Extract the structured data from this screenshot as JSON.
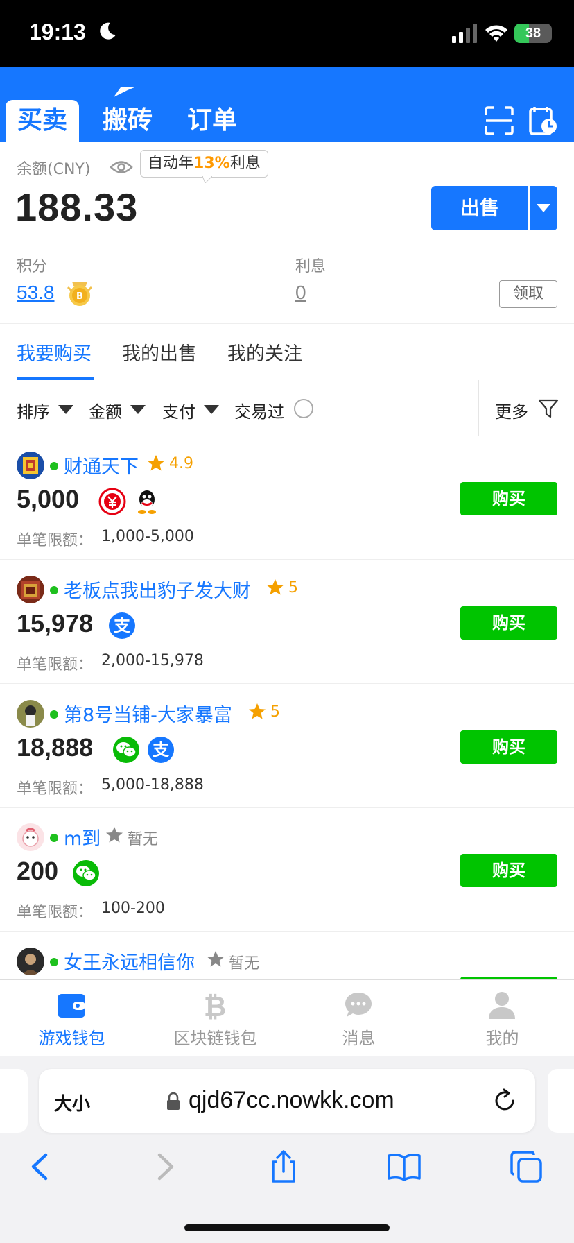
{
  "status_bar": {
    "time": "19:13",
    "battery": "38",
    "battery_level": 0.38
  },
  "header": {
    "tabs": [
      {
        "label": "买卖",
        "active": true
      },
      {
        "label": "搬砖",
        "active": false
      },
      {
        "label": "订单",
        "active": false
      }
    ],
    "icons": [
      "scan-icon",
      "history-clock-icon"
    ]
  },
  "balance": {
    "label": "余额(CNY)",
    "tip_prefix": "自动年",
    "tip_rate": "13%",
    "tip_suffix": "利息",
    "value": "188.33",
    "sell_label": "出售",
    "points_label": "积分",
    "points_value": "53.8",
    "interest_label": "利息",
    "interest_value": "0",
    "claim_label": "领取"
  },
  "subtabs": [
    {
      "label": "我要购买",
      "active": true
    },
    {
      "label": "我的出售",
      "active": false
    },
    {
      "label": "我的关注",
      "active": false
    }
  ],
  "filters": {
    "sort": "排序",
    "amount": "金额",
    "payment": "支付",
    "traded": "交易过",
    "more": "更多"
  },
  "listings": [
    {
      "seller": "财通天下",
      "rating": "4.9",
      "amount": "5,000",
      "payments": [
        "digital-rmb-icon",
        "qq-icon"
      ],
      "limit_label": "单笔限额：",
      "limit": "1,000-5,000",
      "buy_label": "购买"
    },
    {
      "seller": "老板点我出豹子发大财",
      "rating": "5",
      "amount": "15,978",
      "payments": [
        "alipay-icon"
      ],
      "limit_label": "单笔限额：",
      "limit": "2,000-15,978",
      "buy_label": "购买"
    },
    {
      "seller": "第8号当铺-大家暴富",
      "rating": "5",
      "amount": "18,888",
      "payments": [
        "wechat-pay-icon",
        "alipay-icon"
      ],
      "limit_label": "单笔限额：",
      "limit": "5,000-18,888",
      "buy_label": "购买"
    },
    {
      "seller": "m到",
      "rating": "暂无",
      "amount": "200",
      "payments": [
        "wechat-pay-icon"
      ],
      "limit_label": "单笔限额：",
      "limit": "100-200",
      "buy_label": "购买"
    },
    {
      "seller": "女王永远相信你",
      "rating": "暂无"
    }
  ],
  "bottom_nav": [
    {
      "label": "游戏钱包",
      "icon": "wallet-icon",
      "active": true
    },
    {
      "label": "区块链钱包",
      "icon": "bitcoin-icon",
      "active": false
    },
    {
      "label": "消息",
      "icon": "chat-bubble-icon",
      "active": false
    },
    {
      "label": "我的",
      "icon": "user-icon",
      "active": false
    }
  ],
  "browser": {
    "text_size_label": "大小",
    "url": "qjd67cc.nowkk.com"
  },
  "colors": {
    "brand_blue": "#1677ff",
    "buy_green": "#00c400",
    "rating_orange": "#f5a000",
    "online_green": "#1ec01e"
  }
}
